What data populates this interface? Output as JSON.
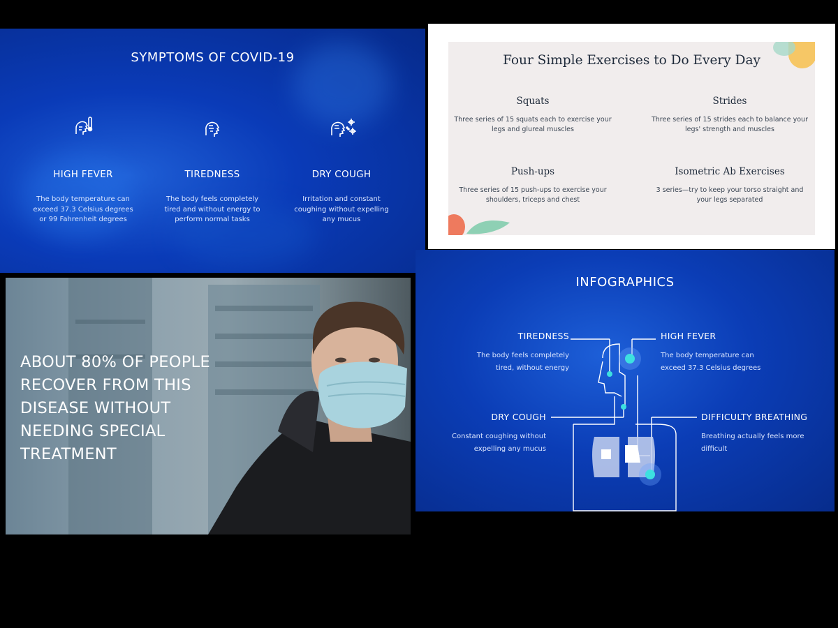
{
  "slide1": {
    "title": "SYMPTOMS OF COVID-19",
    "items": [
      {
        "heading": "HIGH FEVER",
        "desc": "The body temperature can exceed 37.3 Celsius degrees or 99 Fahrenheit degrees",
        "icon": "fever-head-icon"
      },
      {
        "heading": "TIREDNESS",
        "desc": "The body feels completely tired and without energy to perform normal tasks",
        "icon": "tired-head-icon"
      },
      {
        "heading": "DRY COUGH",
        "desc": "Irritation and constant coughing without expelling any mucus",
        "icon": "cough-head-icon"
      }
    ]
  },
  "slide2": {
    "title": "Four Simple Exercises to Do Every Day",
    "items": [
      {
        "heading": "Squats",
        "desc": "Three series of 15 squats each to exercise your legs and glureal muscles"
      },
      {
        "heading": "Strides",
        "desc": "Three series of 15 strides each to balance your legs' strength and muscles"
      },
      {
        "heading": "Push-ups",
        "desc": "Three series of 15 push-ups to exercise your shoulders, triceps and chest"
      },
      {
        "heading": "Isometric Ab Exercises",
        "desc": "3 series—try to keep your torso straight and your legs separated"
      }
    ]
  },
  "slide3": {
    "caption": "ABOUT 80% OF PEOPLE RECOVER FROM THIS DISEASE WITHOUT NEEDING SPECIAL TREATMENT"
  },
  "slide4": {
    "title": "INFOGRAPHICS",
    "labels": {
      "tiredness": {
        "heading": "TIREDNESS",
        "desc": "The body feels completely tired, without energy"
      },
      "fever": {
        "heading": "HIGH FEVER",
        "desc": "The body temperature can exceed 37.3 Celsius degrees"
      },
      "cough": {
        "heading": "DRY COUGH",
        "desc": "Constant coughing without expelling any mucus"
      },
      "breathing": {
        "heading": "DIFFICULTY BREATHING",
        "desc": "Breathing actually feels more difficult"
      }
    }
  },
  "colors": {
    "blue_dark": "#072c8c",
    "blue_mid": "#0b3db6",
    "accent_cyan": "#3de0e0",
    "card_bg": "#f1eded"
  }
}
